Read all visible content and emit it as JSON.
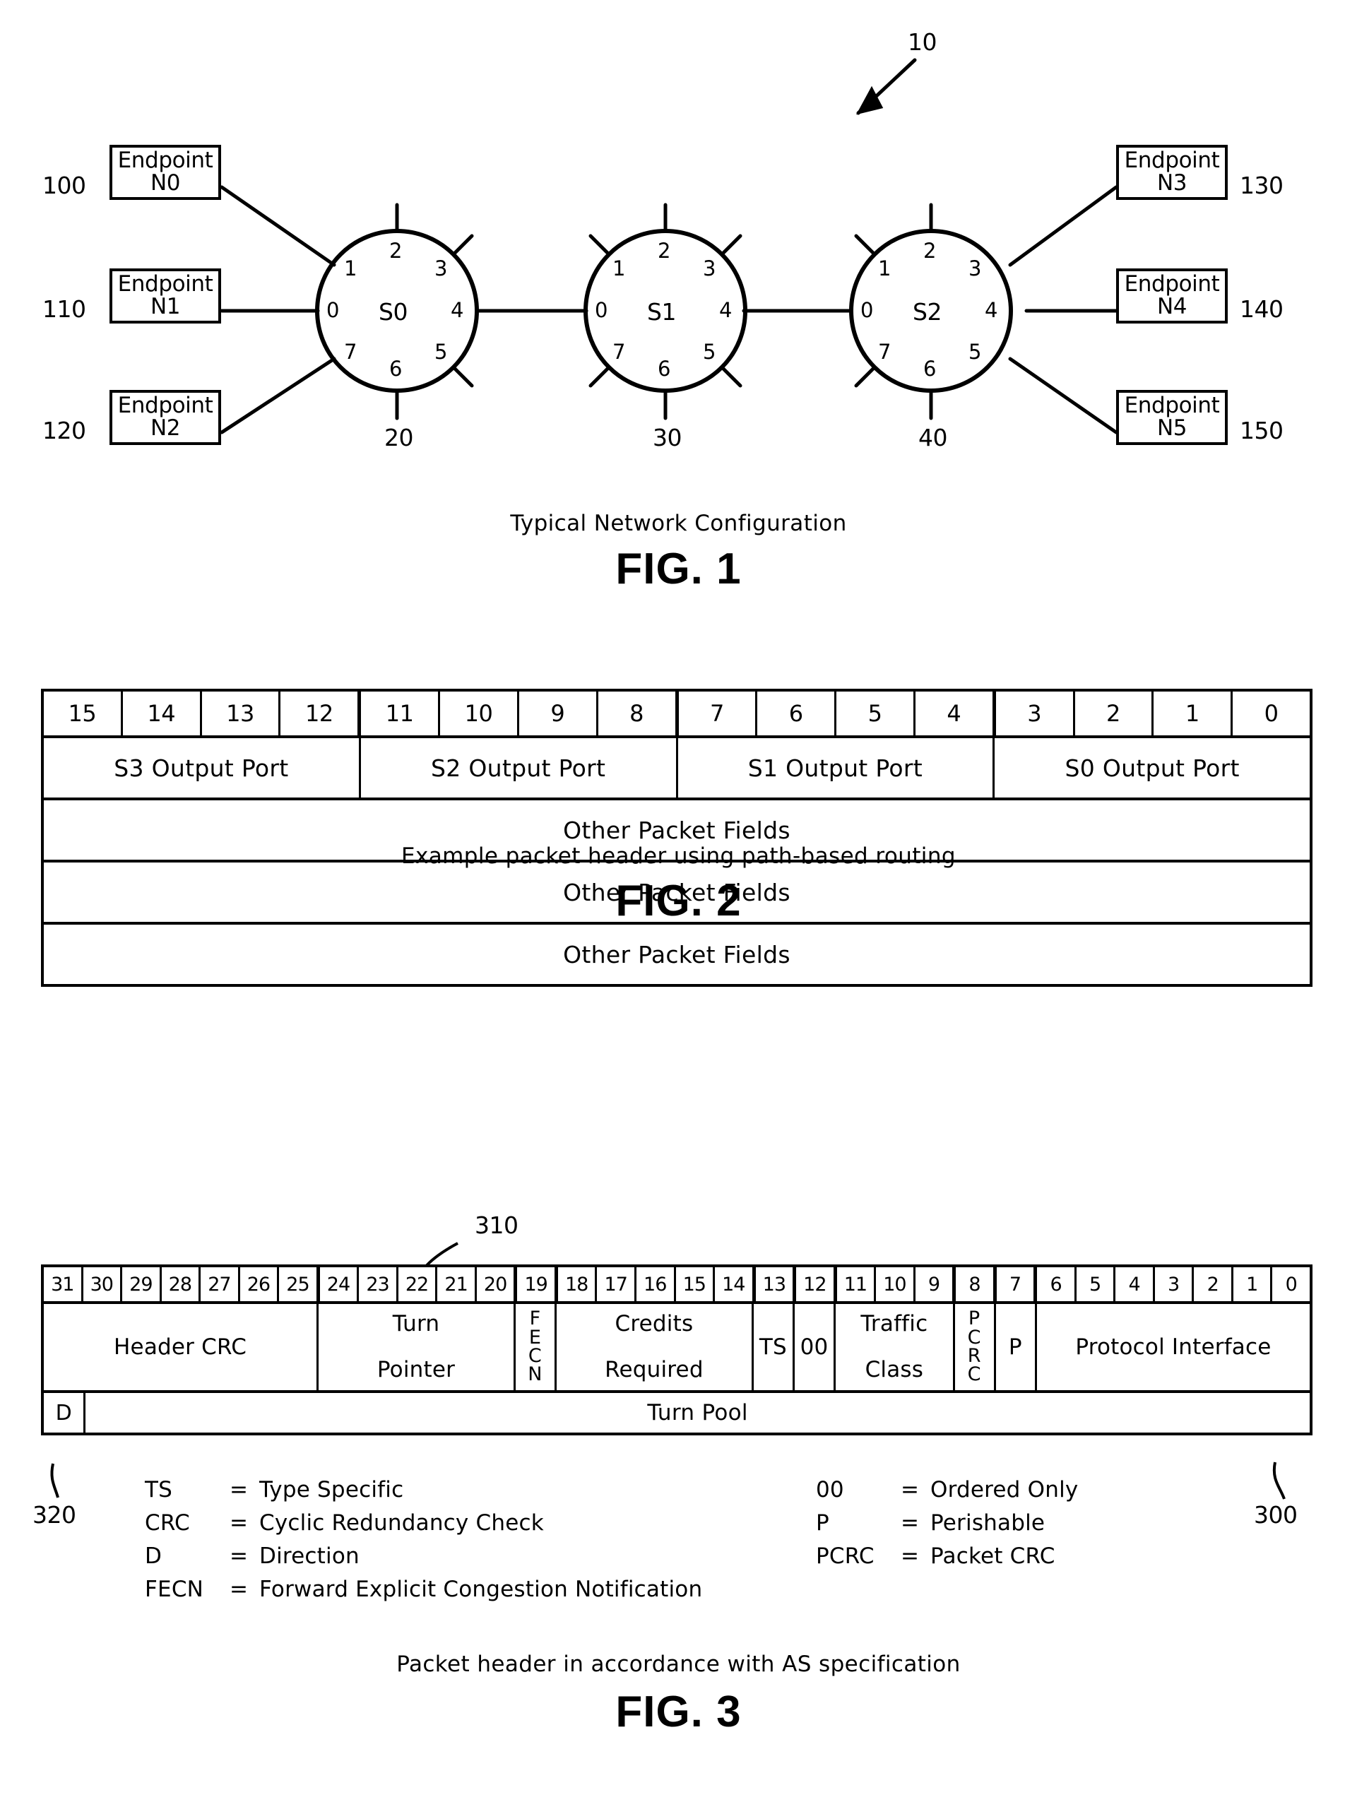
{
  "figure1": {
    "top_ref": "10",
    "caption": "Typical Network Configuration",
    "title": "FIG. 1",
    "endpoints_left": [
      {
        "ref": "100",
        "line1": "Endpoint",
        "line2": "N0"
      },
      {
        "ref": "110",
        "line1": "Endpoint",
        "line2": "N1"
      },
      {
        "ref": "120",
        "line1": "Endpoint",
        "line2": "N2"
      }
    ],
    "endpoints_right": [
      {
        "ref": "130",
        "line1": "Endpoint",
        "line2": "N3"
      },
      {
        "ref": "140",
        "line1": "Endpoint",
        "line2": "N4"
      },
      {
        "ref": "150",
        "line1": "Endpoint",
        "line2": "N5"
      }
    ],
    "switches": [
      {
        "label": "S0",
        "ref": "20",
        "ports": [
          "0",
          "1",
          "2",
          "3",
          "4",
          "5",
          "6",
          "7"
        ]
      },
      {
        "label": "S1",
        "ref": "30",
        "ports": [
          "0",
          "1",
          "2",
          "3",
          "4",
          "5",
          "6",
          "7"
        ]
      },
      {
        "label": "S2",
        "ref": "40",
        "ports": [
          "0",
          "1",
          "2",
          "3",
          "4",
          "5",
          "6",
          "7"
        ]
      }
    ]
  },
  "figure2": {
    "caption": "Example packet header using path-based routing",
    "title": "FIG. 2",
    "bit_numbers": [
      "15",
      "14",
      "13",
      "12",
      "11",
      "10",
      "9",
      "8",
      "7",
      "6",
      "5",
      "4",
      "3",
      "2",
      "1",
      "0"
    ],
    "port_fields": [
      "S3 Output Port",
      "S2 Output Port",
      "S1 Output Port",
      "S0 Output Port"
    ],
    "other_rows": [
      "Other Packet Fields",
      "Other Packet Fields",
      "Other Packet Fields"
    ]
  },
  "figure3": {
    "caption": "Packet header in accordance with AS specification",
    "title": "FIG. 3",
    "ref_turn_pointer": "310",
    "ref_direction": "320",
    "ref_header": "300",
    "bit_numbers": [
      "31",
      "30",
      "29",
      "28",
      "27",
      "26",
      "25",
      "24",
      "23",
      "22",
      "21",
      "20",
      "19",
      "18",
      "17",
      "16",
      "15",
      "14",
      "13",
      "12",
      "11",
      "10",
      "9",
      "8",
      "7",
      "6",
      "5",
      "4",
      "3",
      "2",
      "1",
      "0"
    ],
    "fields": [
      {
        "name": "Header CRC",
        "bits": 7,
        "orientation": "horizontal"
      },
      {
        "name": "Turn Pointer",
        "bits": 5,
        "orientation": "horizontal"
      },
      {
        "name": "FECN",
        "bits": 1,
        "orientation": "vertical"
      },
      {
        "name": "Credits Required",
        "bits": 5,
        "orientation": "horizontal"
      },
      {
        "name": "TS",
        "bits": 1,
        "orientation": "horizontal"
      },
      {
        "name": "00",
        "bits": 1,
        "orientation": "horizontal"
      },
      {
        "name": "Traffic Class",
        "bits": 3,
        "orientation": "horizontal"
      },
      {
        "name": "PCRC",
        "bits": 1,
        "orientation": "vertical"
      },
      {
        "name": "P",
        "bits": 1,
        "orientation": "horizontal"
      },
      {
        "name": "Protocol Interface",
        "bits": 7,
        "orientation": "horizontal"
      }
    ],
    "second_row": {
      "direction_cell": "D",
      "pool_cell": "Turn Pool"
    },
    "legend_left": [
      {
        "abbr": "TS",
        "eq": "=",
        "def": "Type Specific"
      },
      {
        "abbr": "CRC",
        "eq": "=",
        "def": "Cyclic Redundancy Check"
      },
      {
        "abbr": "D",
        "eq": "=",
        "def": "Direction"
      },
      {
        "abbr": "FECN",
        "eq": "=",
        "def": "Forward Explicit Congestion Notification"
      }
    ],
    "legend_right": [
      {
        "abbr": "00",
        "eq": "=",
        "def": "Ordered Only"
      },
      {
        "abbr": "P",
        "eq": "=",
        "def": "Perishable"
      },
      {
        "abbr": "PCRC",
        "eq": "=",
        "def": "Packet CRC"
      }
    ]
  }
}
